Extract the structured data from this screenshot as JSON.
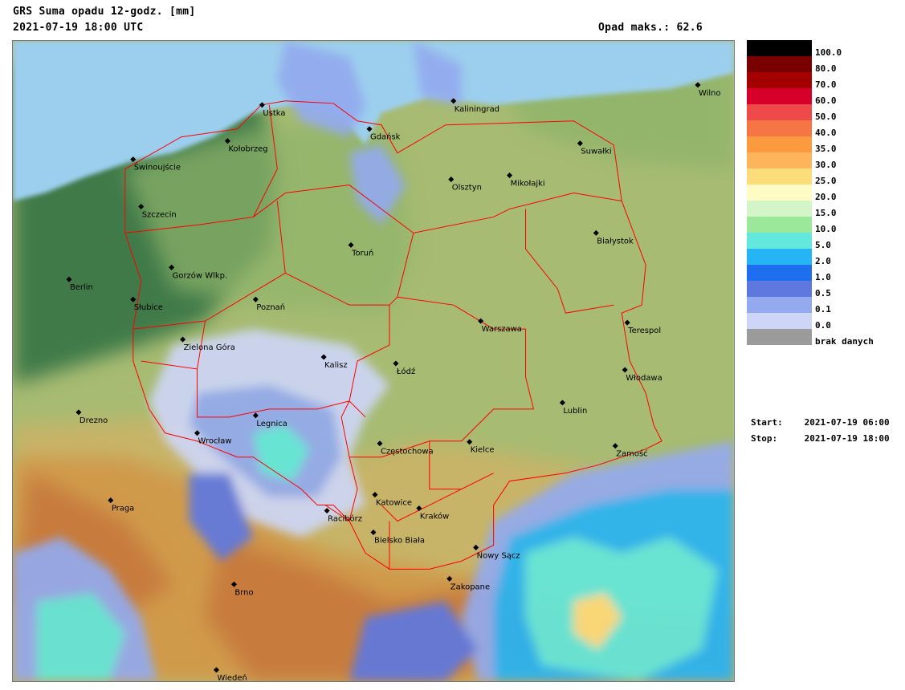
{
  "header": {
    "title": "GRS Suma opadu 12-godz. [mm]",
    "datetime": "2021-07-19 18:00 UTC",
    "max_label": "Opad maks.:",
    "max_value": "62.6"
  },
  "legend": [
    {
      "label": "100.0",
      "color": "#000000"
    },
    {
      "label": "80.0",
      "color": "#7a0000"
    },
    {
      "label": "70.0",
      "color": "#a50000"
    },
    {
      "label": "60.0",
      "color": "#d7002a"
    },
    {
      "label": "50.0",
      "color": "#ee4a4a"
    },
    {
      "label": "40.0",
      "color": "#f57545"
    },
    {
      "label": "35.0",
      "color": "#fb9a3e"
    },
    {
      "label": "30.0",
      "color": "#fdb45b"
    },
    {
      "label": "25.0",
      "color": "#fddc7a"
    },
    {
      "label": "20.0",
      "color": "#fefbc4"
    },
    {
      "label": "15.0",
      "color": "#d3f5c8"
    },
    {
      "label": "10.0",
      "color": "#9be89b"
    },
    {
      "label": "5.0",
      "color": "#62e8dc"
    },
    {
      "label": "2.0",
      "color": "#25b4f4"
    },
    {
      "label": "1.0",
      "color": "#1e6ff0"
    },
    {
      "label": "0.5",
      "color": "#5f78e0"
    },
    {
      "label": "0.1",
      "color": "#93aaee"
    },
    {
      "label": "0.0",
      "color": "#cdd6f6"
    },
    {
      "label": "brak danych",
      "color": "#9b9b9b"
    }
  ],
  "period": {
    "start_label": "Start:",
    "start_value": "2021-07-19 06:00",
    "stop_label": "Stop:",
    "stop_value": "2021-07-19 18:00"
  },
  "map": {
    "cities": [
      "Ustka",
      "Gdańsk",
      "Kaliningrad",
      "Wilno",
      "Suwałki",
      "Olsztyn",
      "Mikołajki",
      "Kołobrzeg",
      "Świnoujście",
      "Szczecin",
      "Gorzów Wlkp.",
      "Berlin",
      "Słubice",
      "Toruń",
      "Białystok",
      "Poznań",
      "Warszawa",
      "Terespol",
      "Zielona Góra",
      "Kalisz",
      "Łódź",
      "Włodawa",
      "Drezno",
      "Lublin",
      "Legnica",
      "Wrocław",
      "Częstochowa",
      "Kielce",
      "Zamość",
      "Praga",
      "Katowice",
      "Kraków",
      "Racibórz",
      "Bielsko Biała",
      "Nowy Sącz",
      "Zakopane",
      "Brno",
      "Wiedeń"
    ],
    "colors": {
      "sea": "#9ccfee",
      "lowland_dark": "#3f7a4a",
      "lowland": "#8fb46a",
      "plain": "#a7bb72",
      "upland": "#c7b468",
      "hills": "#d09a4c",
      "mountains": "#c77b3c",
      "border": "#ff0000"
    }
  }
}
